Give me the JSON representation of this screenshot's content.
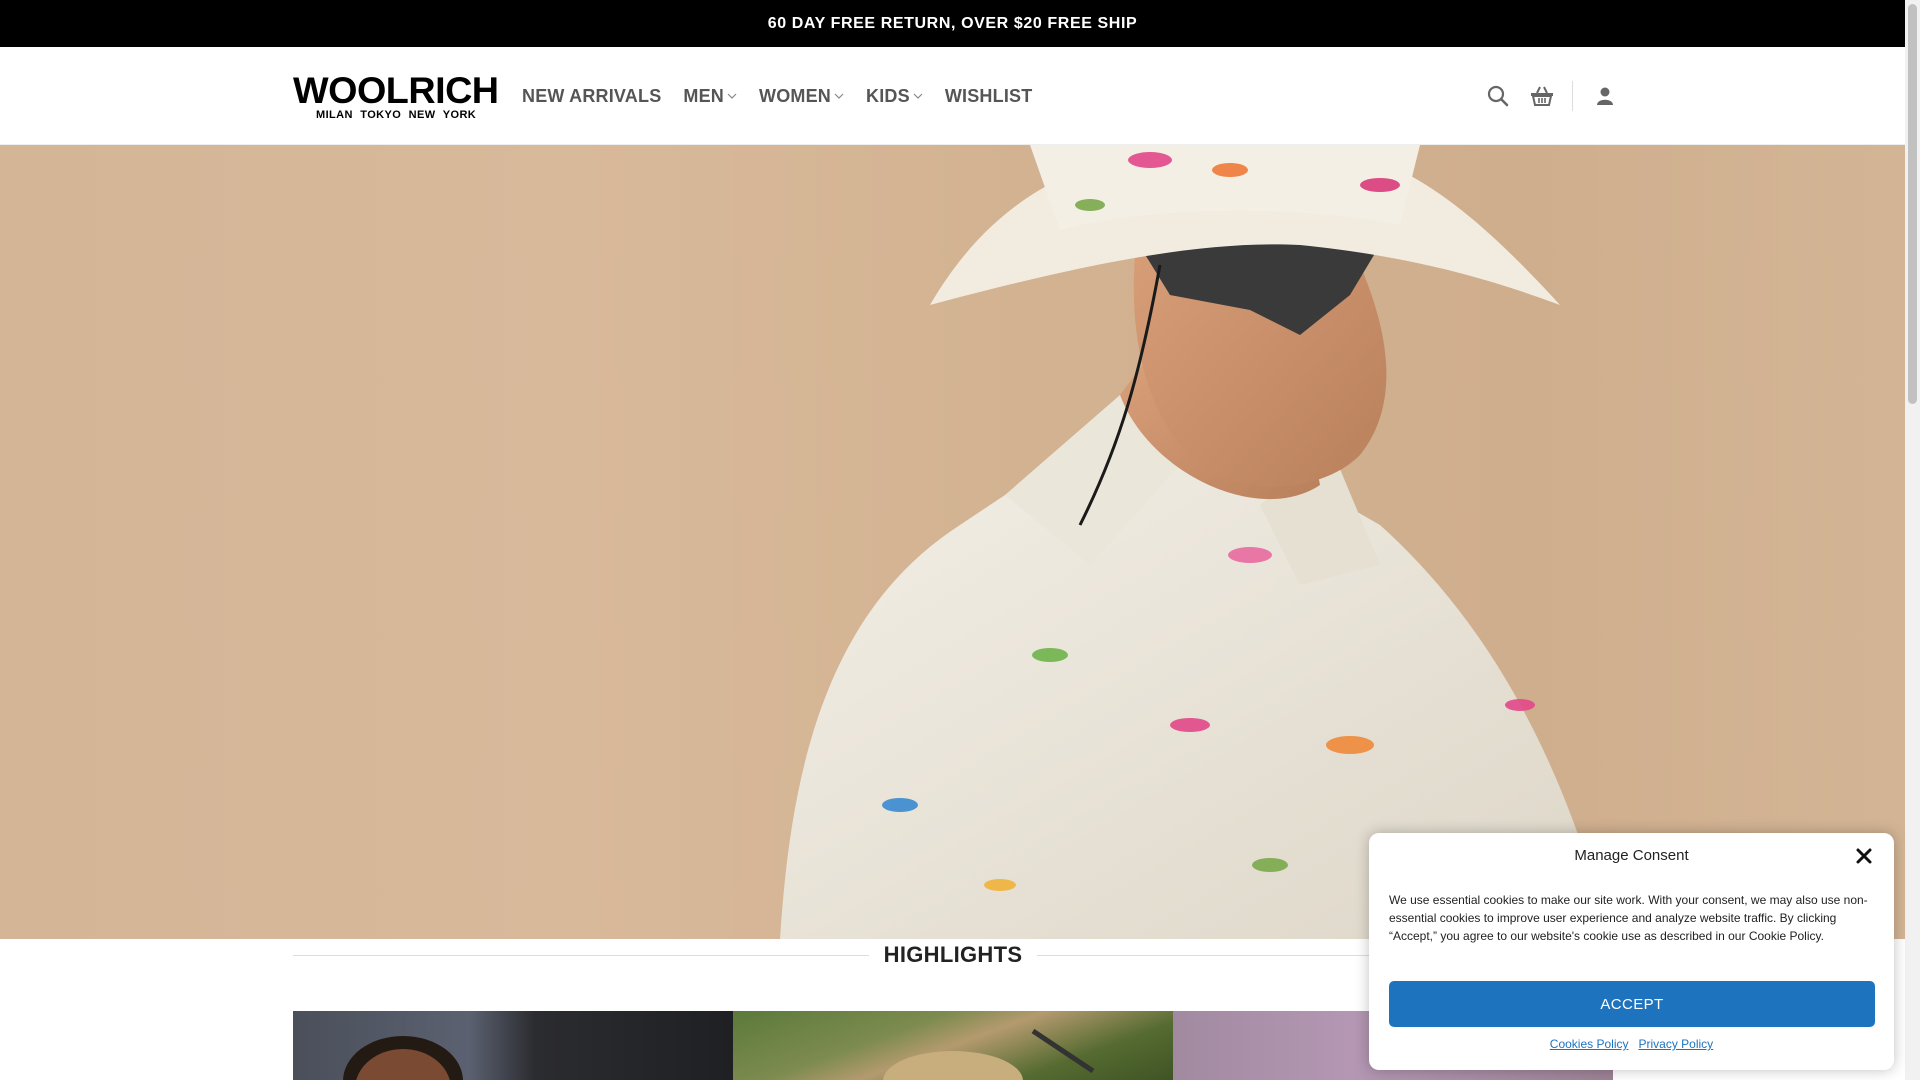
{
  "announcement": "60 DAY FREE RETURN, OVER $20 FREE SHIP",
  "brand": {
    "name": "WOOLRICH",
    "tagline": "MILAN TOKYO NEW YORK"
  },
  "nav": [
    {
      "label": "NEW ARRIVALS",
      "dropdown": false
    },
    {
      "label": "MEN",
      "dropdown": true
    },
    {
      "label": "WOMEN",
      "dropdown": true
    },
    {
      "label": "KIDS",
      "dropdown": true
    },
    {
      "label": "WISHLIST",
      "dropdown": false
    }
  ],
  "header_icons": [
    "search-icon",
    "basket-icon",
    "user-icon"
  ],
  "section": {
    "highlights_title": "HIGHLIGHTS"
  },
  "consent": {
    "title": "Manage Consent",
    "message": "We use essential cookies to make our site work. With your consent, we may also use non-essential cookies to improve user experience and analyze website traffic. By clicking “Accept,” you agree to our website's cookie use as described in our Cookie Policy.",
    "accept_label": "ACCEPT",
    "cookies_policy_label": "Cookies Policy",
    "privacy_policy_label": "Privacy Policy"
  },
  "colors": {
    "accent": "#1e73be",
    "topbar": "#000000",
    "nav_text": "#555555"
  }
}
